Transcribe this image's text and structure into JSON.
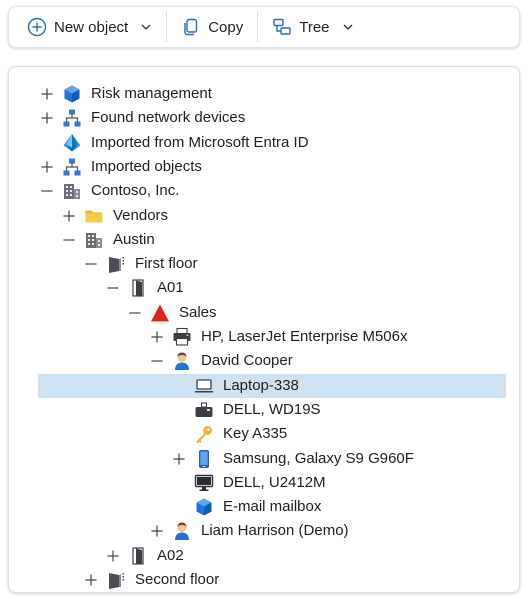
{
  "toolbar": {
    "new_object_label": "New object",
    "copy_label": "Copy",
    "tree_label": "Tree"
  },
  "tree": {
    "selected_item": "Laptop-338",
    "nodes": [
      {
        "label": "Risk management",
        "icon": "cube-icon",
        "toggle": "expand"
      },
      {
        "label": "Found network devices",
        "icon": "network-icon",
        "toggle": "expand"
      },
      {
        "label": "Imported from Microsoft Entra ID",
        "icon": "entra-id-icon",
        "toggle": "none"
      },
      {
        "label": "Imported objects",
        "icon": "network-icon",
        "toggle": "expand"
      },
      {
        "label": "Contoso, Inc.",
        "icon": "building-icon",
        "toggle": "collapse"
      },
      {
        "label": "Vendors",
        "icon": "folder-icon",
        "toggle": "expand"
      },
      {
        "label": "Austin",
        "icon": "building-icon",
        "toggle": "collapse"
      },
      {
        "label": "First floor",
        "icon": "floor-icon",
        "toggle": "collapse"
      },
      {
        "label": "A01",
        "icon": "door-icon",
        "toggle": "collapse"
      },
      {
        "label": "Sales",
        "icon": "triangle-icon",
        "toggle": "collapse"
      },
      {
        "label": "HP, LaserJet Enterprise M506x",
        "icon": "printer-icon",
        "toggle": "expand"
      },
      {
        "label": "David Cooper",
        "icon": "person-icon",
        "toggle": "collapse"
      },
      {
        "label": "Laptop-338",
        "icon": "laptop-icon",
        "toggle": "none"
      },
      {
        "label": "DELL, WD19S",
        "icon": "dock-icon",
        "toggle": "none"
      },
      {
        "label": "Key A335",
        "icon": "key-icon",
        "toggle": "none"
      },
      {
        "label": "Samsung, Galaxy S9 G960F",
        "icon": "phone-icon",
        "toggle": "expand"
      },
      {
        "label": "DELL, U2412M",
        "icon": "monitor-icon",
        "toggle": "none"
      },
      {
        "label": "E-mail mailbox",
        "icon": "cube-icon",
        "toggle": "none"
      },
      {
        "label": "Liam Harrison (Demo)",
        "icon": "person-icon",
        "toggle": "expand"
      },
      {
        "label": "A02",
        "icon": "door-icon",
        "toggle": "expand"
      },
      {
        "label": "Second floor",
        "icon": "floor-icon",
        "toggle": "expand"
      }
    ]
  }
}
